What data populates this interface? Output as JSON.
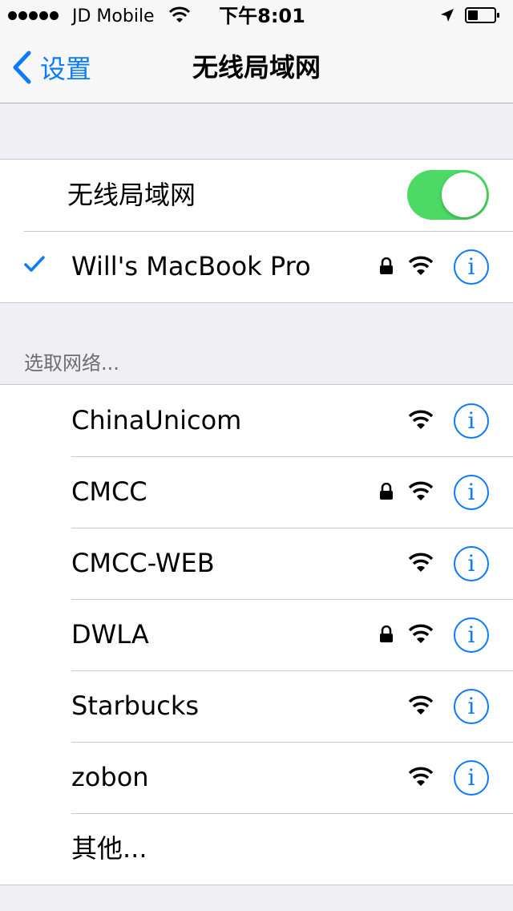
{
  "status_bar": {
    "carrier": "JD Mobile",
    "time": "下午8:01"
  },
  "nav": {
    "back_label": "设置",
    "title": "无线局域网"
  },
  "wifi_toggle": {
    "label": "无线局域网",
    "on": true
  },
  "connected_network": {
    "name": "Will's MacBook Pro",
    "locked": true
  },
  "section_header": "选取网络...",
  "networks": [
    {
      "name": "ChinaUnicom",
      "locked": false
    },
    {
      "name": "CMCC",
      "locked": true
    },
    {
      "name": "CMCC-WEB",
      "locked": false
    },
    {
      "name": "DWLA",
      "locked": true
    },
    {
      "name": "Starbucks",
      "locked": false
    },
    {
      "name": "zobon",
      "locked": false
    }
  ],
  "other_label": "其他...",
  "info_glyph": "i",
  "colors": {
    "accent": "#0a7aff",
    "toggle_on": "#4cd964",
    "background": "#efeff4"
  }
}
